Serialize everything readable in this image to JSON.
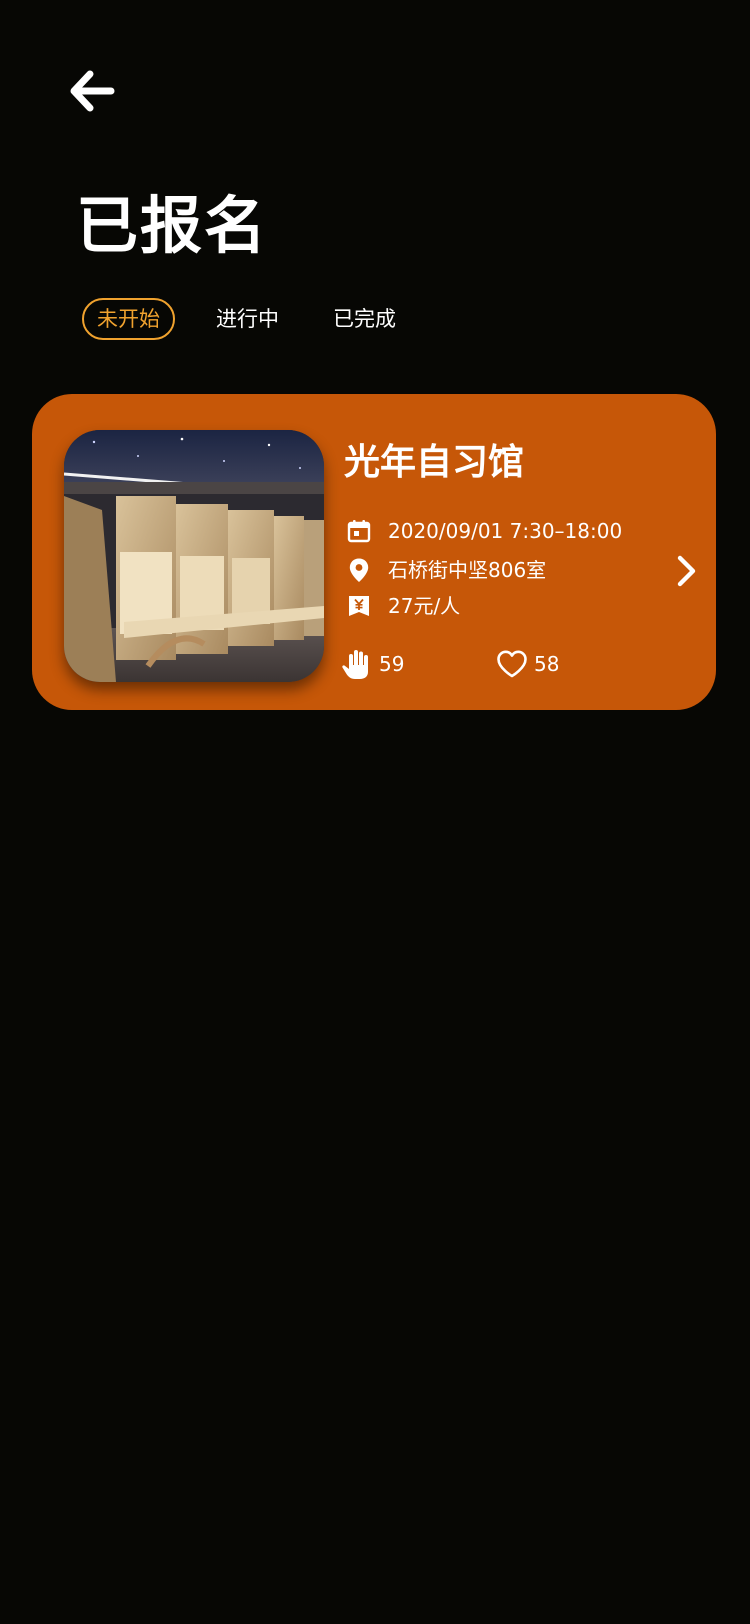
{
  "header": {
    "back_icon": "arrow-left-icon",
    "title": "已报名"
  },
  "tabs": [
    {
      "label": "未开始",
      "active": true
    },
    {
      "label": "进行中",
      "active": false
    },
    {
      "label": "已完成",
      "active": false
    }
  ],
  "colors": {
    "background": "#070704",
    "card": "#c65708",
    "tab_active": "#f0a22e",
    "text": "#ffffff"
  },
  "card": {
    "name": "光年自习馆",
    "time": "2020/09/01 7:30–18:00",
    "address": "石桥街中坚806室",
    "price": "27元/人",
    "raise_count": "59",
    "like_count": "58",
    "icons": {
      "time": "calendar-icon",
      "address": "location-pin-icon",
      "price": "yuan-ticket-icon",
      "raise": "raised-hand-icon",
      "like": "heart-icon",
      "open": "chevron-right-icon"
    }
  }
}
